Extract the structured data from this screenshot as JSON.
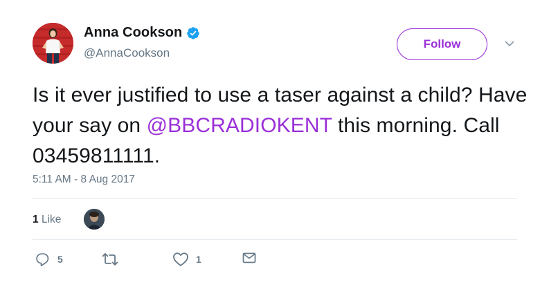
{
  "author": {
    "display_name": "Anna Cookson",
    "handle": "@AnnaCookson",
    "verified": true
  },
  "follow_button": {
    "label": "Follow"
  },
  "tweet": {
    "text_before": "Is it ever justified to use a taser against a child? Have your say on ",
    "mention": "@BBCRADIOKENT",
    "text_after": " this morning. Call 03459811111.",
    "timestamp": "5:11 AM - 8 Aug 2017"
  },
  "stats": {
    "likes_count": "1",
    "likes_label": "Like"
  },
  "actions": {
    "reply_count": "5",
    "like_count": "1"
  },
  "colors": {
    "accent": "#9b30d9",
    "muted": "#657786",
    "text": "#14171a",
    "divider": "#e6ecf0"
  },
  "icons": {
    "verified": "verified-badge-icon",
    "caret": "chevron-down-icon",
    "reply": "reply-icon",
    "retweet": "retweet-icon",
    "like": "heart-icon",
    "dm": "envelope-icon"
  }
}
